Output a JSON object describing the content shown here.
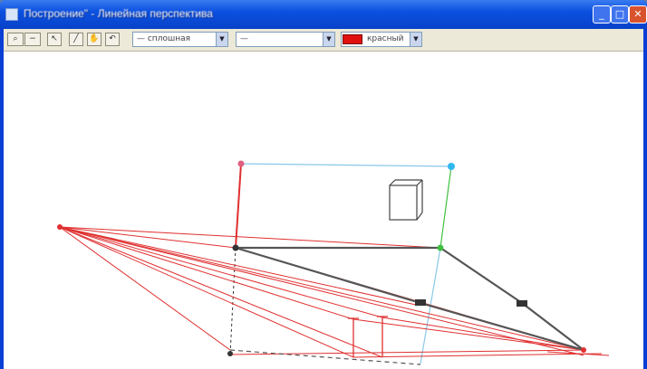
{
  "window": {
    "title": "Построение\" - Линейная перспектива",
    "controls": {
      "minimize": "_",
      "maximize": "□",
      "close": "✕"
    }
  },
  "toolbar": {
    "tools": [
      {
        "name": "zoom-tool",
        "label": "⌕"
      },
      {
        "name": "zoom-out-tool",
        "label": "−"
      },
      {
        "name": "pointer-tool",
        "label": "↖"
      },
      {
        "name": "line-tool",
        "label": "╱"
      },
      {
        "name": "hand-tool",
        "label": "✋"
      },
      {
        "name": "undo-tool",
        "label": "↶"
      }
    ],
    "style_select": {
      "value": "— сплошная"
    },
    "width_select": {
      "value": "—"
    },
    "color_select": {
      "value": "красный",
      "color": "#e01010"
    }
  },
  "drawing": {
    "colors": {
      "construction": "#e03030",
      "object": "#555555",
      "vertical": "#3a3a3a",
      "picture_plane": "#88c8e8",
      "green": "#40c040",
      "point_cyan": "#30b8f0"
    }
  }
}
